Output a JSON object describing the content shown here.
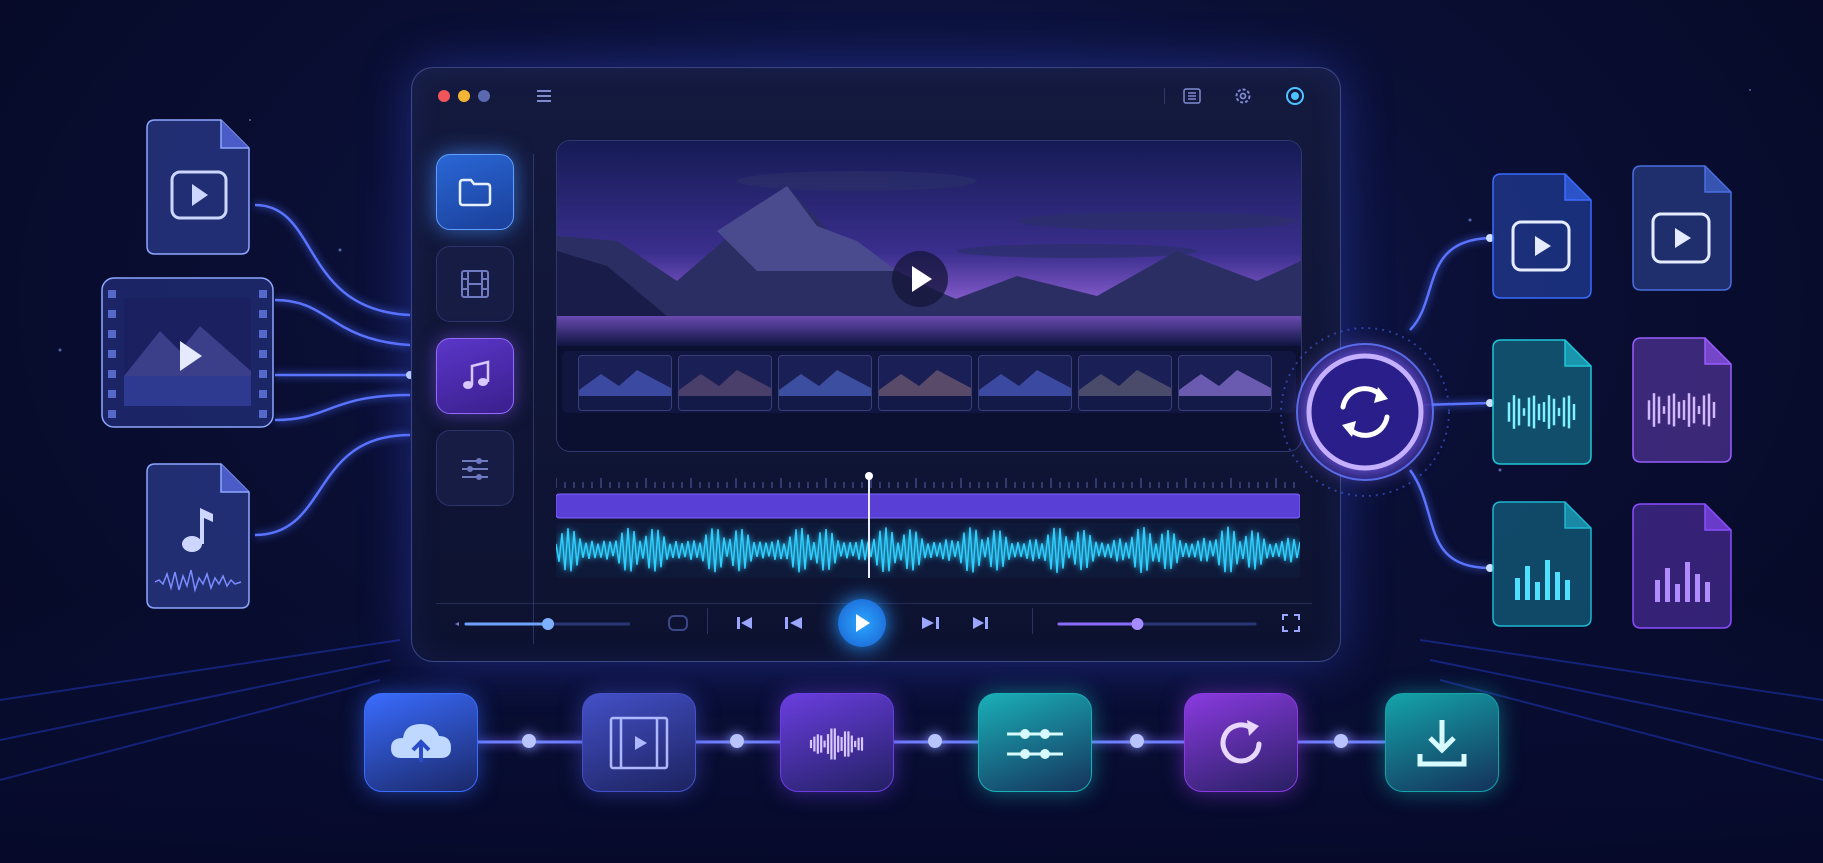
{
  "window": {
    "traffic_lights": {
      "close": "#f0555a",
      "minimize": "#f5b534",
      "zoom": "#5b6ab0"
    },
    "titlebar_icons": [
      "menu-icon",
      "list-icon",
      "gear-icon",
      "record-icon"
    ]
  },
  "sidebar": {
    "items": [
      {
        "icon": "folder-icon",
        "state": "active"
      },
      {
        "icon": "film-icon",
        "state": "default"
      },
      {
        "icon": "music-note-icon",
        "state": "selected"
      },
      {
        "icon": "sliders-icon",
        "state": "default"
      }
    ]
  },
  "preview": {
    "scene": "mountain-lake-night",
    "filmstrip_frames": 7,
    "play_icon": "play-icon"
  },
  "timeline": {
    "playhead": 0.42,
    "video_track_color": "#5a3fd6",
    "audio_track_color": "#2fd0ff"
  },
  "player_controls": {
    "volume": 0.5,
    "buttons": [
      "skip-start-icon",
      "previous-icon",
      "play-icon",
      "next-icon",
      "skip-end-icon"
    ],
    "progress": 0.4,
    "fullscreen_icon": "fullscreen-icon"
  },
  "inputs": [
    "video-file-icon",
    "film-frame-icon",
    "audio-file-icon"
  ],
  "convert": {
    "icon": "convert-icon"
  },
  "outputs": [
    {
      "icon": "video-file-icon",
      "color": "#3b6cff"
    },
    {
      "icon": "video-file-icon",
      "color": "#4a6ee0"
    },
    {
      "icon": "waveform-file-icon",
      "color": "#1fc6d8"
    },
    {
      "icon": "waveform-file-icon",
      "color": "#9a5cff"
    },
    {
      "icon": "bars-file-icon",
      "color": "#1fb6d0"
    },
    {
      "icon": "bars-file-icon",
      "color": "#8a4cff"
    }
  ],
  "pipeline": [
    {
      "icon": "cloud-upload-icon",
      "color": "#3a6cff"
    },
    {
      "icon": "film-edit-icon",
      "color": "#4450c8"
    },
    {
      "icon": "audio-wave-icon",
      "color": "#6a3ee0"
    },
    {
      "icon": "equalizer-icon",
      "color": "#1ab0b8"
    },
    {
      "icon": "refresh-icon",
      "color": "#8a3ae0"
    },
    {
      "icon": "download-icon",
      "color": "#14a4aa"
    }
  ]
}
